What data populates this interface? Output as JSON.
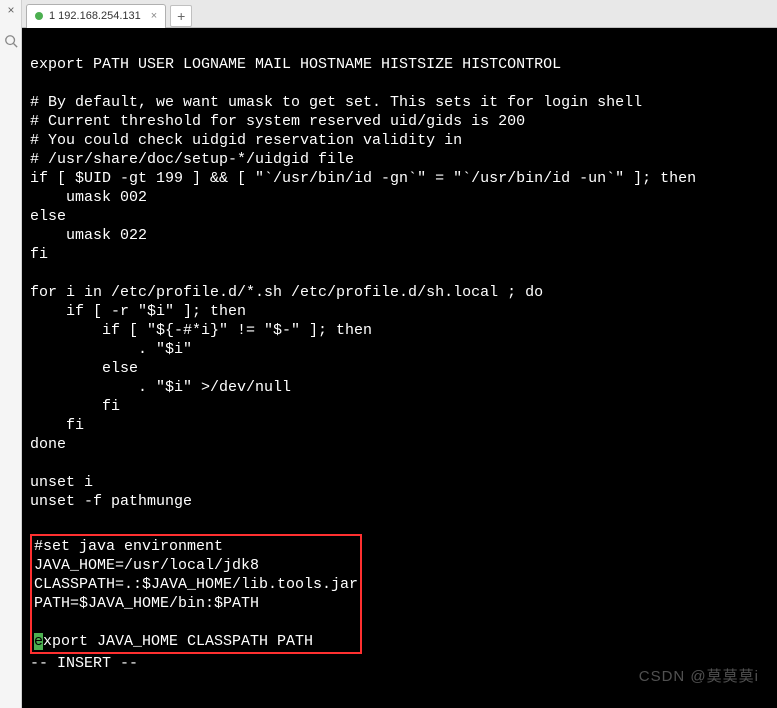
{
  "sidebar": {
    "close_glyph": "×",
    "search_glyph": "🔍"
  },
  "tabs": {
    "active": {
      "label": "1 192.168.254.131",
      "close_glyph": "×"
    },
    "add_glyph": "+"
  },
  "terminal": {
    "lines": [
      "",
      "export PATH USER LOGNAME MAIL HOSTNAME HISTSIZE HISTCONTROL",
      "",
      "# By default, we want umask to get set. This sets it for login shell",
      "# Current threshold for system reserved uid/gids is 200",
      "# You could check uidgid reservation validity in",
      "# /usr/share/doc/setup-*/uidgid file",
      "if [ $UID -gt 199 ] && [ \"`/usr/bin/id -gn`\" = \"`/usr/bin/id -un`\" ]; then",
      "    umask 002",
      "else",
      "    umask 022",
      "fi",
      "",
      "for i in /etc/profile.d/*.sh /etc/profile.d/sh.local ; do",
      "    if [ -r \"$i\" ]; then",
      "        if [ \"${-#*i}\" != \"$-\" ]; then",
      "            . \"$i\"",
      "        else",
      "            . \"$i\" >/dev/null",
      "        fi",
      "    fi",
      "done",
      "",
      "unset i",
      "unset -f pathmunge",
      ""
    ],
    "highlighted": [
      "#set java environment",
      "JAVA_HOME=/usr/local/jdk8",
      "CLASSPATH=.:$JAVA_HOME/lib.tools.jar",
      "PATH=$JAVA_HOME/bin:$PATH"
    ],
    "highlight_cursor_char": "e",
    "highlight_last_rest": "xport JAVA_HOME CLASSPATH PATH",
    "status_line": "-- INSERT --"
  },
  "watermark": "CSDN @莫莫莫i"
}
